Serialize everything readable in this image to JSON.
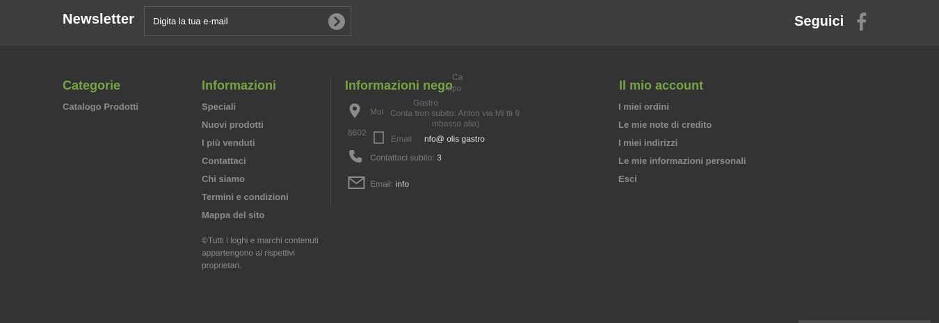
{
  "newsletter": {
    "title": "Newsletter",
    "placeholder": "Digita la tua e-mail",
    "submit_icon": "chevron-right-circle-icon"
  },
  "social": {
    "title": "Seguici",
    "icon": "facebook-icon"
  },
  "columns": {
    "categories": {
      "title": "Categorie",
      "items": [
        "Catalogo Prodotti"
      ]
    },
    "info": {
      "title": "Informazioni",
      "items": [
        "Speciali",
        "Nuovi prodotti",
        "I più venduti",
        "Contattaci",
        "Chi siamo",
        "Termini e condizioni",
        "Mappa del sito"
      ],
      "copyright": "©Tutti i loghi e marchi contenuti appartengono ai rispettivi proprietari."
    },
    "shop": {
      "title": "Informazioni nego",
      "address_line1": "Mol",
      "address_line2": "8602",
      "phone_label": "Contattaci subito:",
      "phone_value": "3",
      "email_label": "Email:",
      "email_value": "info",
      "overlap_1": "Conta tron subito: Anton via Mi tti 9",
      "overlap_2": "Gastro",
      "overlap_3": "mbasso alia)",
      "overlap_4": "Email",
      "overlap_5": "nfo@ olis gastro",
      "overlap_6": "Ca",
      "overlap_7": "mpo"
    },
    "account": {
      "title": "Il mio account",
      "items": [
        "I miei ordini",
        "Le mie note di credito",
        "I miei indirizzi",
        "Le mie informazioni personali",
        "Esci"
      ]
    }
  },
  "colors": {
    "accent": "#78a444",
    "background": "#333333",
    "topbar": "#3d3d3d",
    "link": "#8b8b8b"
  }
}
